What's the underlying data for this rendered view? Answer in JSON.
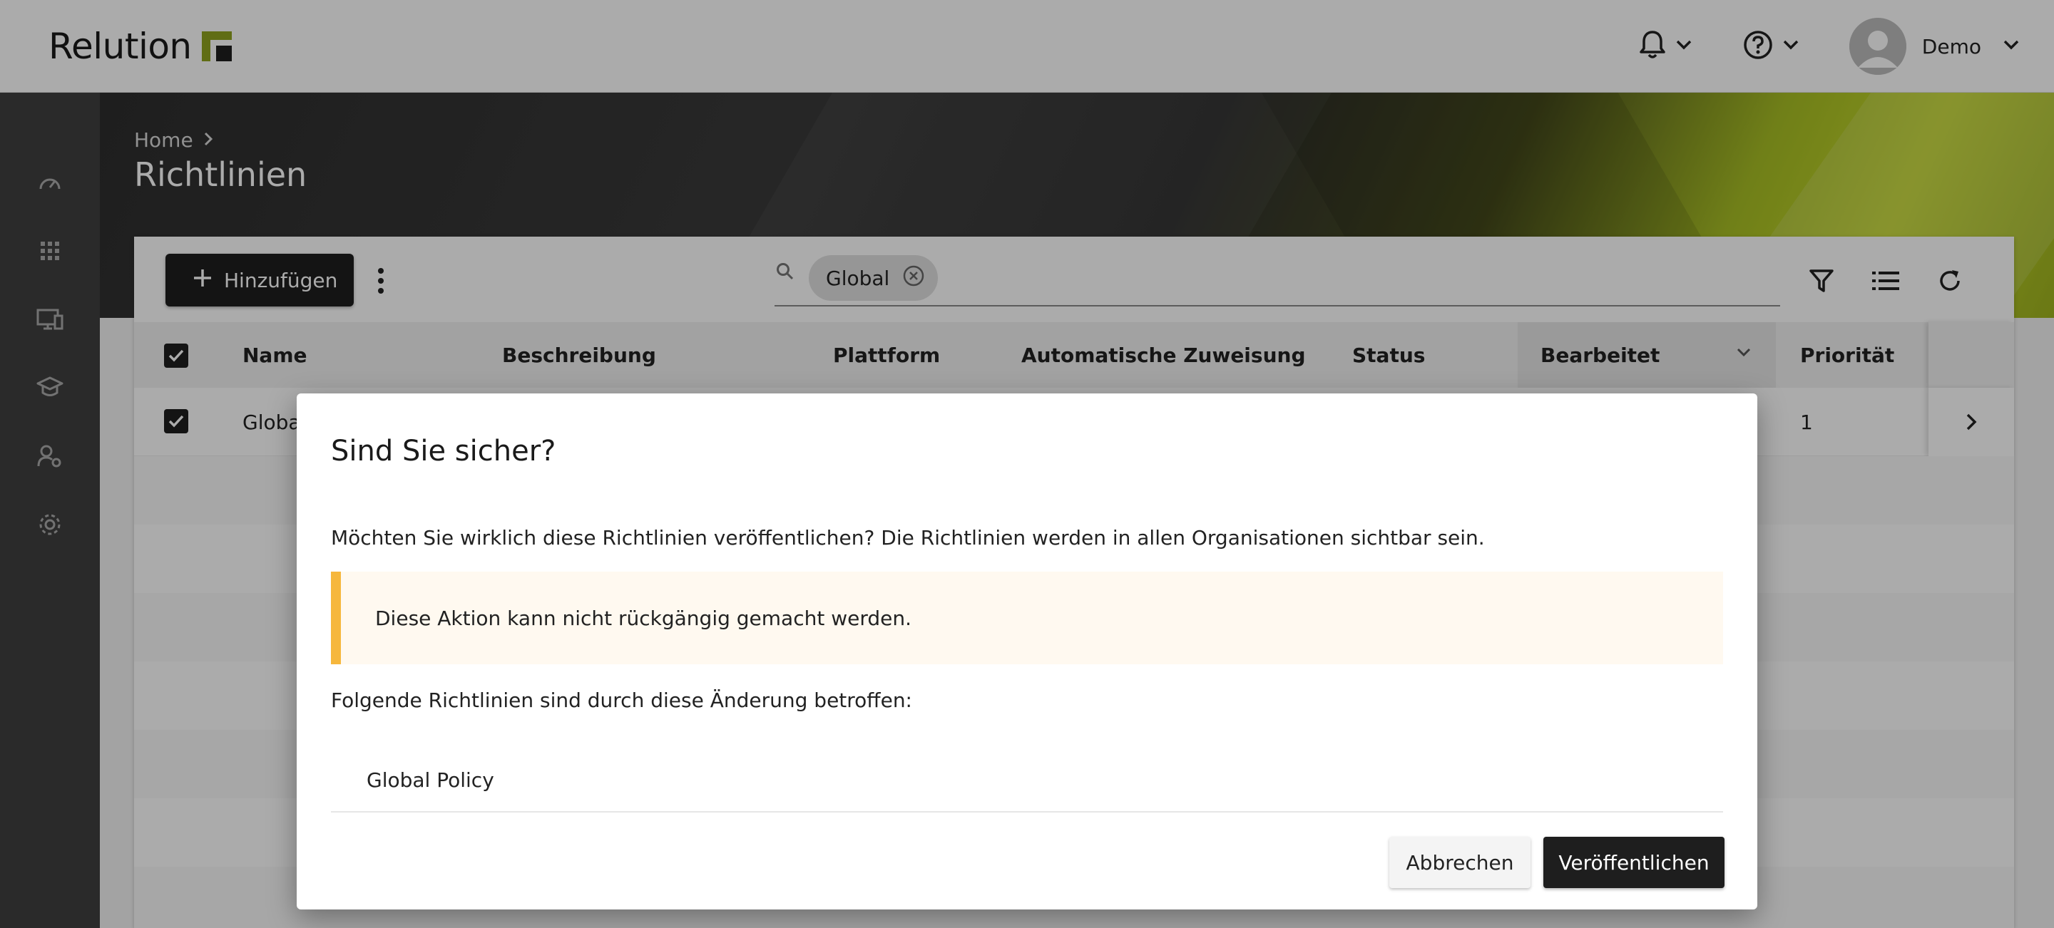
{
  "app": {
    "logo_text": "Relution"
  },
  "header": {
    "notifications_icon": "bell-icon",
    "help_icon": "help-circle-icon",
    "user_name": "Demo"
  },
  "sidebar": {
    "items": [
      {
        "icon": "dashboard-icon"
      },
      {
        "icon": "apps-grid-icon"
      },
      {
        "icon": "devices-icon"
      },
      {
        "icon": "education-icon"
      },
      {
        "icon": "users-settings-icon"
      },
      {
        "icon": "gear-icon"
      }
    ]
  },
  "page": {
    "breadcrumb_home": "Home",
    "title": "Richtlinien"
  },
  "toolbar": {
    "add_label": "Hinzufügen",
    "filter_chip": "Global"
  },
  "table": {
    "columns": [
      "Name",
      "Beschreibung",
      "Plattform",
      "Automatische Zuweisung",
      "Status",
      "Bearbeitet",
      "Priorität"
    ],
    "sorted_column": "Bearbeitet",
    "rows": [
      {
        "name": "Global",
        "priority": "1",
        "selected": true
      }
    ]
  },
  "dialog": {
    "title": "Sind Sie sicher?",
    "message": "Möchten Sie wirklich diese Richtlinien veröffentlichen? Die Richtlinien werden in allen Organisationen sichtbar sein.",
    "warning": "Diese Aktion kann nicht rückgängig gemacht werden.",
    "list_label": "Folgende Richtlinien sind durch diese Änderung betroffen:",
    "affected_policies": [
      "Global Policy"
    ],
    "cancel_label": "Abbrechen",
    "confirm_label": "Veröffentlichen"
  },
  "colors": {
    "brand_green": "#8fa31e",
    "warning_accent": "#f6b73c",
    "primary_button": "#1e1e1e"
  }
}
